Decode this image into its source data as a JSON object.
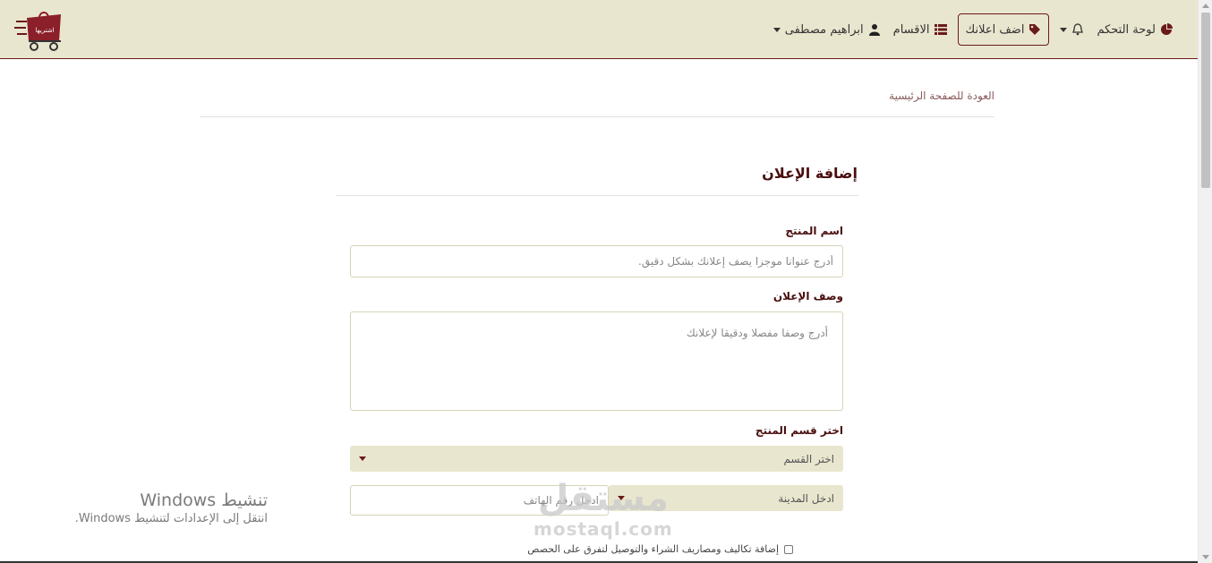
{
  "navbar": {
    "user_name": "ابراهيم مصطفى",
    "categories_label": "الاقسام",
    "add_ad_label": "اضف اعلانك",
    "dashboard_label": "لوحة التحكم",
    "logo_text": "اشتريها"
  },
  "colors": {
    "accent": "#6b1a1a",
    "navbar_bg": "#e9e6cf",
    "title_color": "#4a0f0f"
  },
  "icons": {
    "user": "user-icon",
    "categories": "list-icon",
    "add_ad": "tag-icon",
    "notifications": "bell-icon",
    "dashboard": "pie-chart-icon"
  },
  "page": {
    "back_link": "العودة للصفحة الرئيسية",
    "form_title": "إضافة الإعلان"
  },
  "form": {
    "product_name_label": "اسم المنتج",
    "product_name_placeholder": "أدرج عنوانا موجزا يصف إعلانك بشكل دقيق.",
    "description_label": "وصف الإعلان",
    "description_placeholder": "أدرج وصفا مفصلا ودقيقا لإعلانك",
    "category_label": "اختر قسم المنتج",
    "category_select": "اختر القسم",
    "city_select": "ادخل المدينة",
    "phone_placeholder": "ادخل رقم الهاتف",
    "costs_checkbox_label": "إضافة تكاليف ومصاريف الشراء والتوصيل لتفرق على الحصص"
  },
  "overlay": {
    "windows_title": "تنشيط Windows",
    "windows_sub": "انتقل إلى الإعدادات لتنشيط Windows.",
    "brand_ar": "مستقل",
    "brand_en": "mostaql.com"
  }
}
